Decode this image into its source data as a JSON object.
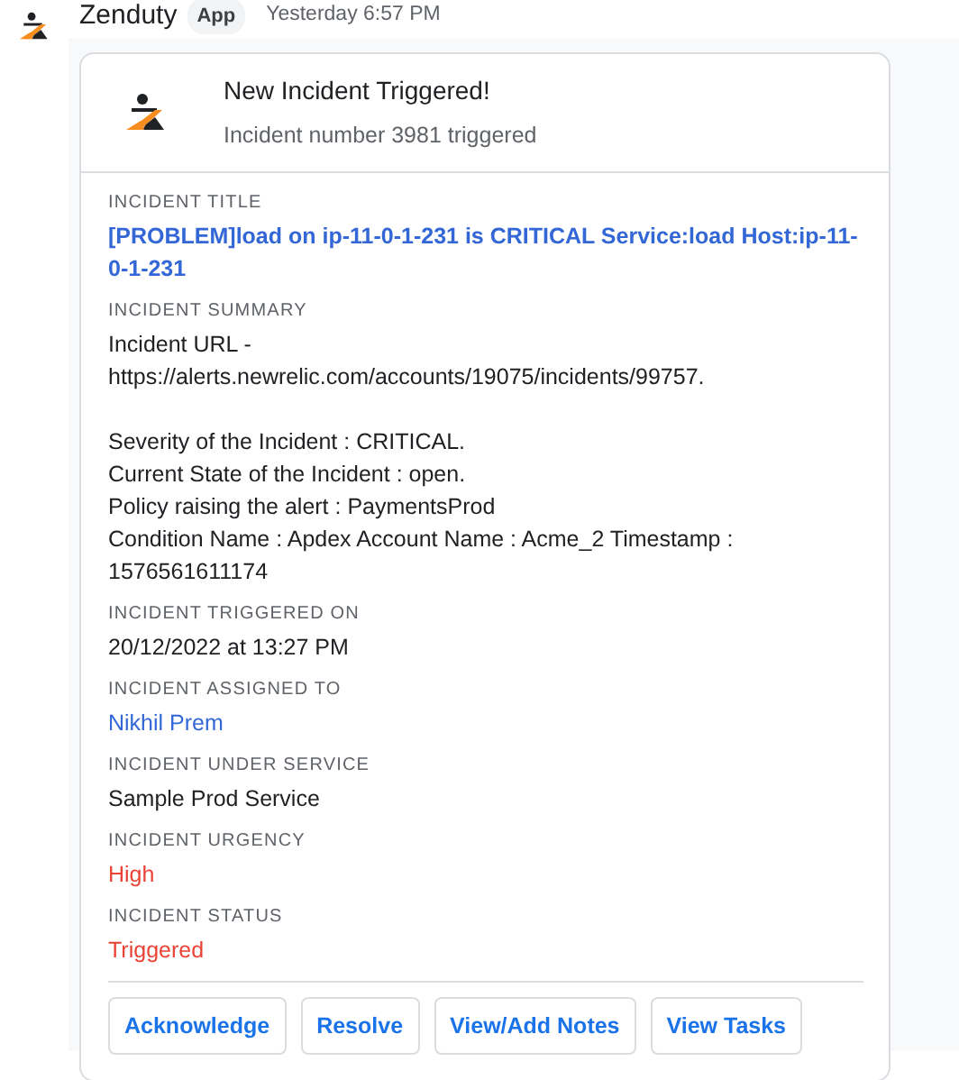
{
  "message": {
    "sender": "Zenduty",
    "badge": "App",
    "time": "Yesterday 6:57 PM"
  },
  "card": {
    "title": "New Incident Triggered!",
    "subtitle": "Incident number 3981 triggered",
    "fields": [
      {
        "label": "INCIDENT TITLE",
        "value": "[PROBLEM]load on ip-11-0-1-231 is CRITICAL Service:load Host:ip-11-0-1-231",
        "kind": "title-link"
      },
      {
        "label": "INCIDENT SUMMARY",
        "value": "Incident URL -\nhttps://alerts.newrelic.com/accounts/19075/incidents/99757.\n\nSeverity of the Incident : CRITICAL.\nCurrent State of the Incident : open.\nPolicy raising the alert : PaymentsProd\nCondition Name : Apdex Account Name : Acme_2 Timestamp :\n1576561611174",
        "kind": "text"
      },
      {
        "label": "INCIDENT TRIGGERED ON",
        "value": "20/12/2022 at 13:27 PM",
        "kind": "text"
      },
      {
        "label": "INCIDENT ASSIGNED TO",
        "value": "Nikhil Prem",
        "kind": "link"
      },
      {
        "label": "INCIDENT UNDER SERVICE",
        "value": "Sample Prod Service",
        "kind": "text"
      },
      {
        "label": "INCIDENT URGENCY",
        "value": "High",
        "kind": "alert"
      },
      {
        "label": "INCIDENT STATUS",
        "value": "Triggered",
        "kind": "alert"
      }
    ],
    "buttons": [
      "Acknowledge",
      "Resolve",
      "View/Add Notes",
      "View Tasks"
    ]
  }
}
